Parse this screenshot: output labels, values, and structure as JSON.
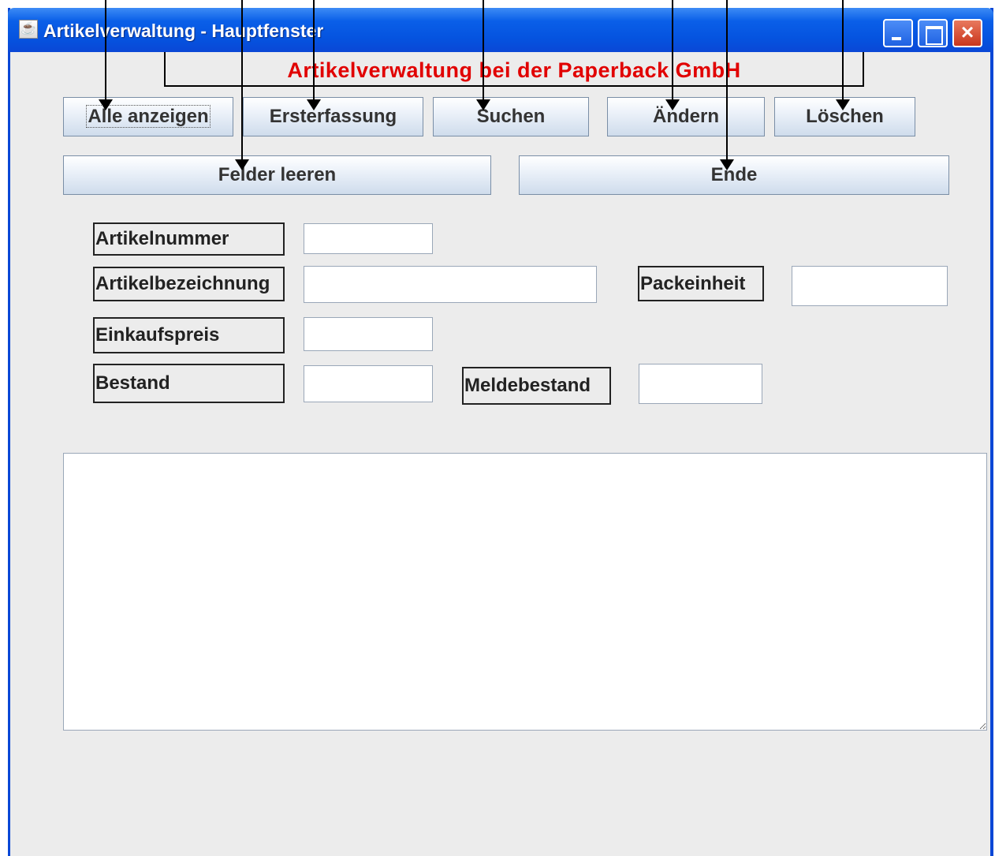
{
  "window": {
    "title": "Artikelverwaltung - Hauptfenster"
  },
  "banner": {
    "text": "Artikelverwaltung bei der Paperback GmbH"
  },
  "buttons": {
    "alle_anzeigen": "Alle anzeigen",
    "ersterfassung": "Ersterfassung",
    "suchen": "Suchen",
    "aendern": "Ändern",
    "loeschen": "Löschen",
    "felder_leeren": "Felder leeren",
    "ende": "Ende"
  },
  "fields": {
    "artikelnummer": {
      "label": "Artikelnummer",
      "value": ""
    },
    "artikelbezeichnung": {
      "label": "Artikelbezeichnung",
      "value": ""
    },
    "packeinheit": {
      "label": "Packeinheit",
      "value": ""
    },
    "einkaufspreis": {
      "label": "Einkaufspreis",
      "value": ""
    },
    "bestand": {
      "label": "Bestand",
      "value": ""
    },
    "meldebestand": {
      "label": "Meldebestand",
      "value": ""
    }
  },
  "output": {
    "value": ""
  },
  "colors": {
    "banner_text": "#e10000",
    "titlebar": "#0553df",
    "window_bg": "#ececec"
  },
  "icons": {
    "app": "java-coffee-icon",
    "minimize": "minimize-icon",
    "maximize": "maximize-icon",
    "close": "close-icon"
  }
}
